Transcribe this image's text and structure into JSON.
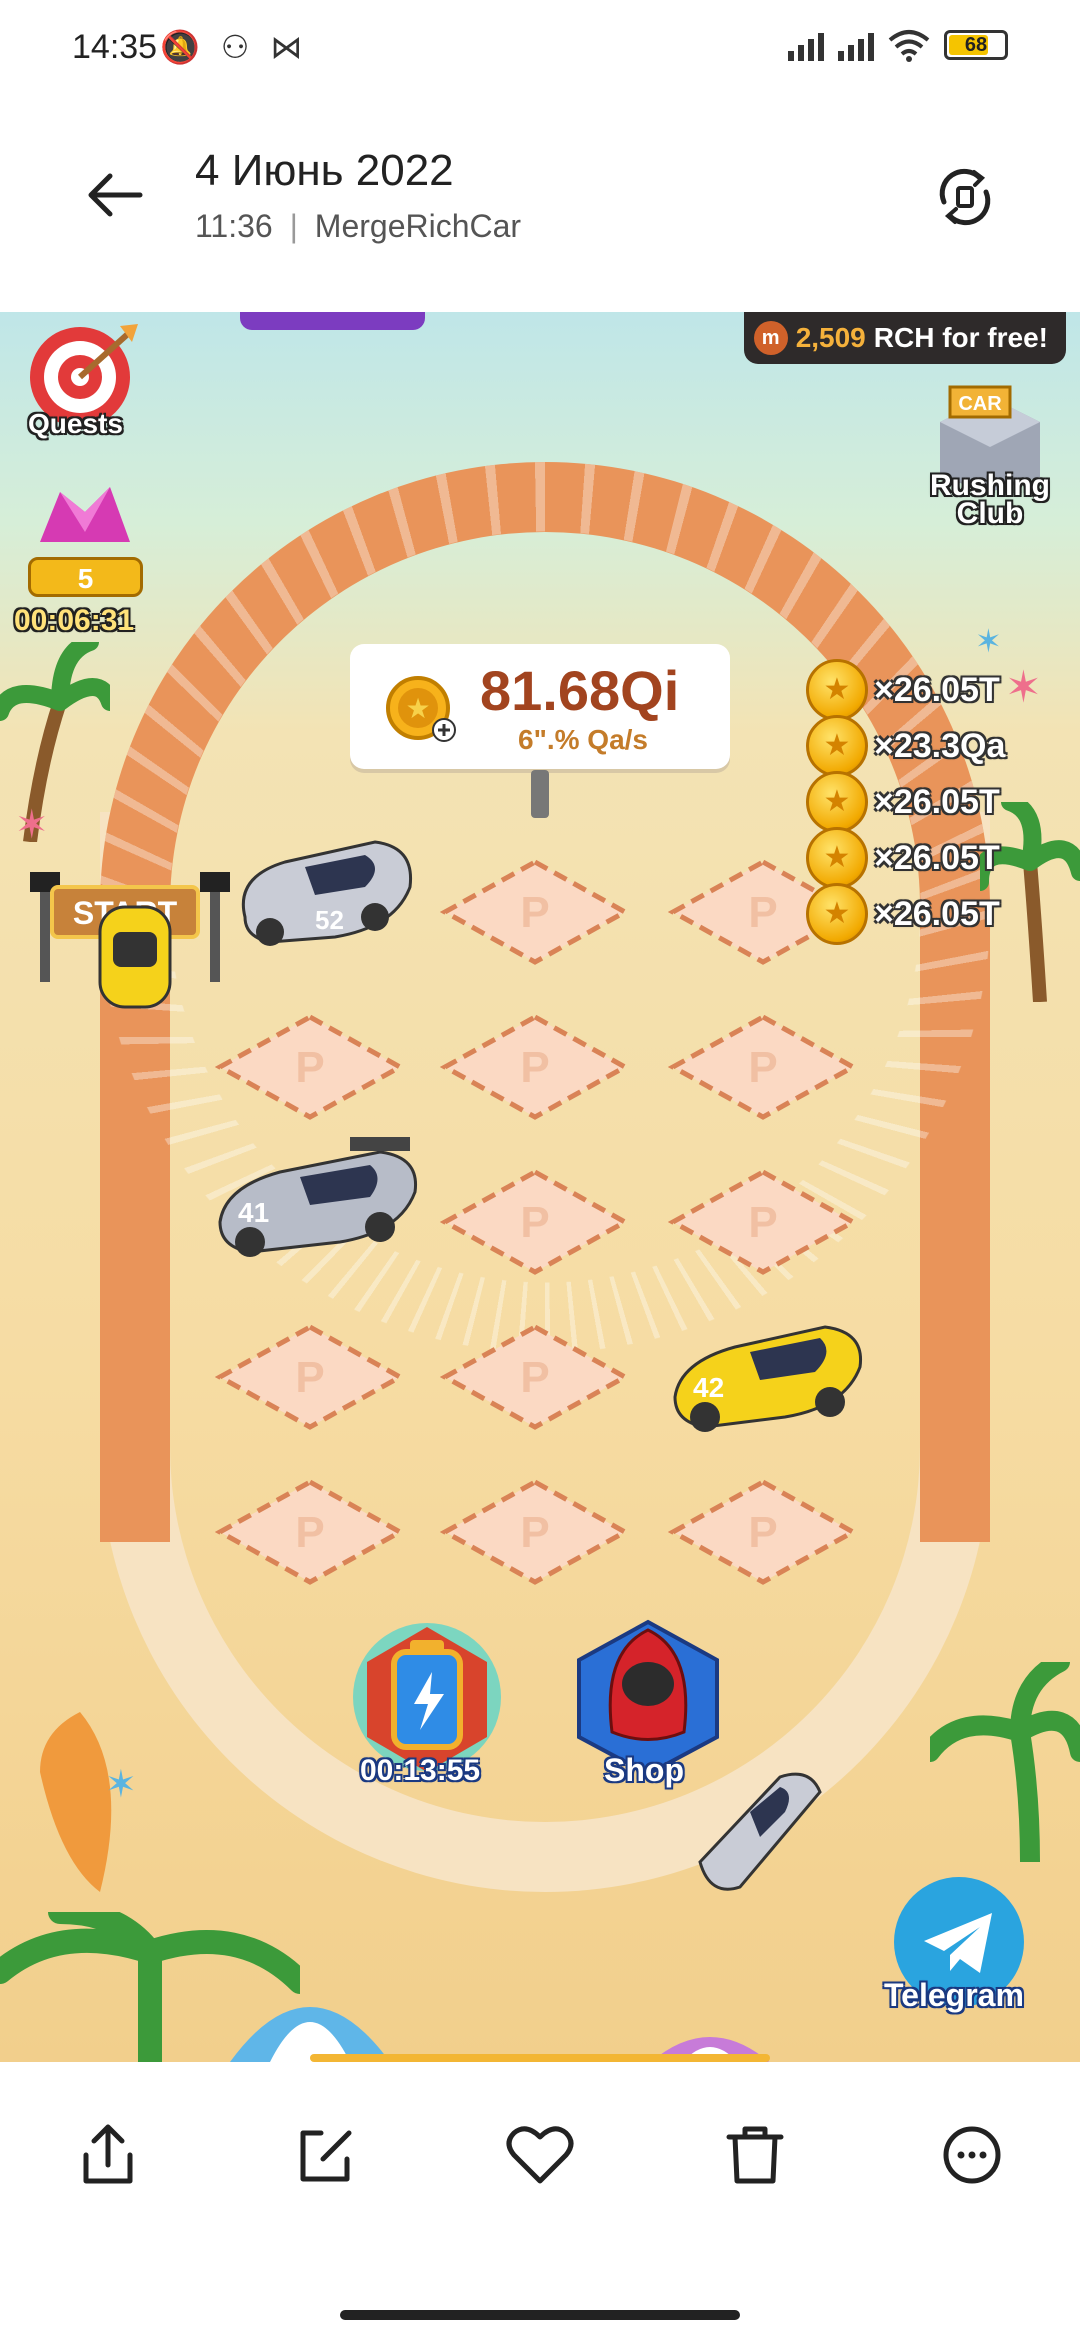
{
  "status_bar": {
    "time": "14:35",
    "battery": "68"
  },
  "header": {
    "title": "4 Июнь 2022",
    "time": "11:36",
    "separator": "|",
    "app": "MergeRichCar"
  },
  "game": {
    "quests_label": "Quests",
    "gem_level": "5",
    "gem_timer": "00:06:31",
    "rch_amount": "2,509",
    "rch_text": "RCH for free!",
    "club_label_1": "Rushing",
    "club_label_2": "Club",
    "club_sign": "CAR",
    "score_value": "81.68Qi",
    "score_rate": "6\".% Qa/s",
    "start_label": "START",
    "multipliers": [
      "×26.05T",
      "×23.3Qa",
      "×26.05T",
      "×26.05T",
      "×26.05T"
    ],
    "car_numbers": [
      "52",
      "41",
      "42"
    ],
    "booster_timer": "00:13:55",
    "shop_label": "Shop",
    "telegram_label": "Telegram"
  },
  "icons": {
    "back": "arrow-left-icon",
    "rotate": "rotate-icon",
    "share": "share-icon",
    "edit": "edit-icon",
    "favorite": "heart-icon",
    "delete": "trash-icon",
    "more": "more-icon"
  },
  "colors": {
    "track": "#e9945a",
    "score_text": "#a2441f",
    "telegram": "#2aa4df"
  }
}
